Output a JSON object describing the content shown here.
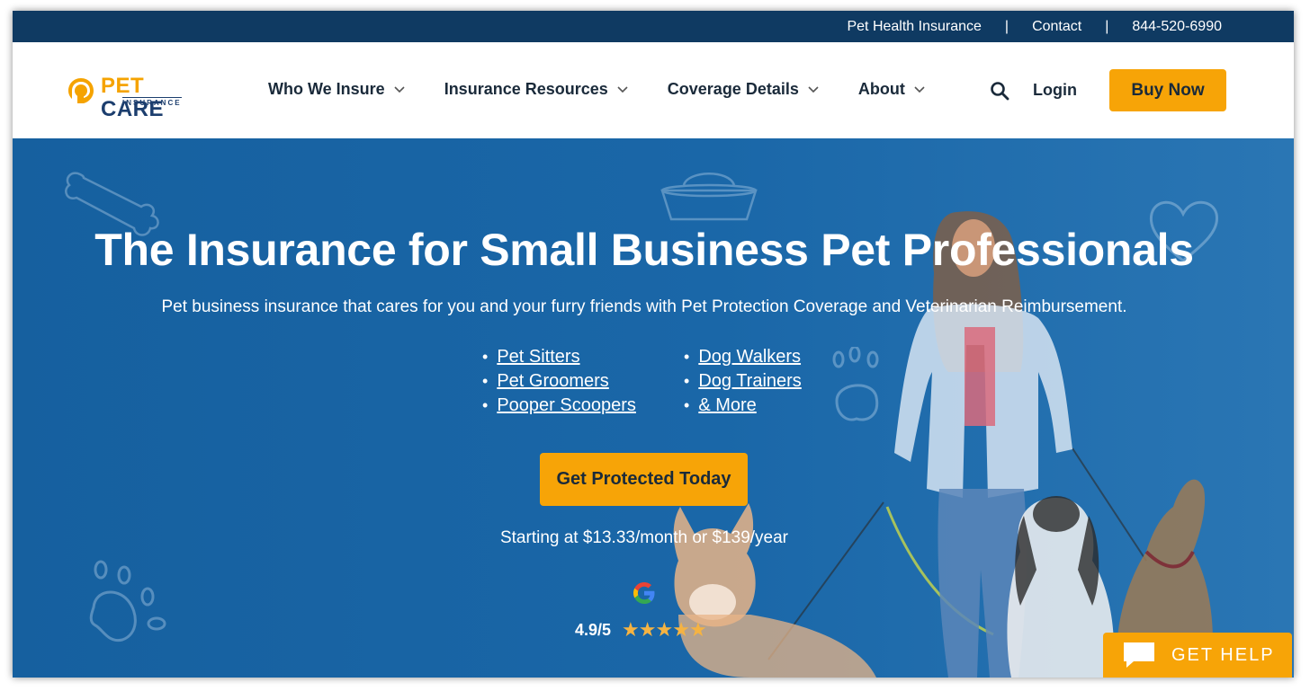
{
  "topbar": {
    "link1": "Pet Health Insurance",
    "separator": "|",
    "link2": "Contact",
    "phone": "844-520-6990"
  },
  "brand": {
    "name_part1": "PET",
    "name_part2": " CARE",
    "sub": "INSURANCE"
  },
  "nav": {
    "items": [
      {
        "label": "Who We Insure"
      },
      {
        "label": "Insurance Resources"
      },
      {
        "label": "Coverage Details"
      },
      {
        "label": "About"
      }
    ],
    "login": "Login",
    "buy": "Buy Now"
  },
  "hero": {
    "title": "The Insurance for Small Business Pet Professionals",
    "subtitle": "Pet business insurance that cares for you and your furry friends with Pet Protection Coverage and Veterinarian Reimbursement.",
    "list_left": [
      "Pet Sitters",
      "Pet Groomers",
      "Pooper Scoopers"
    ],
    "list_right": [
      "Dog Walkers",
      "Dog Trainers",
      "& More"
    ],
    "cta": "Get Protected Today",
    "price": "Starting at $13.33/month or $139/year",
    "rating": "4.9/5",
    "stars": "★★★★★"
  },
  "help": {
    "label": "GET HELP"
  },
  "colors": {
    "topbar": "#0f3a62",
    "hero": "#1a67a8",
    "accent": "#f7a407",
    "navy": "#1c3e6e"
  },
  "icons": [
    "logo-mark-icon",
    "chevron-down-icon",
    "search-icon",
    "google-icon",
    "star-icon",
    "chat-bubble-icon",
    "bone-icon",
    "bowl-icon",
    "heart-icon",
    "paw-icon"
  ]
}
